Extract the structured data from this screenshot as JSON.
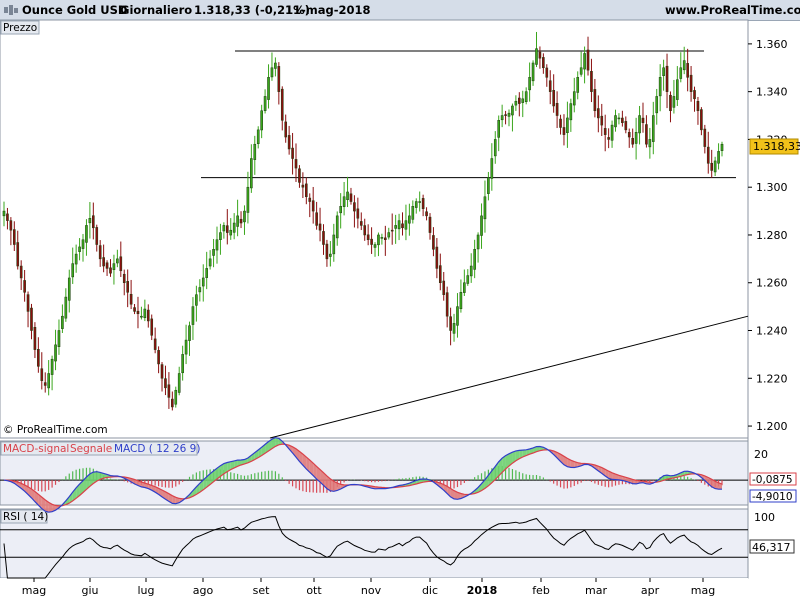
{
  "header": {
    "instrument": "Ounce Gold USD",
    "timeframe": "Giornaliero",
    "last_quote": "1.318,33 (-0,21%)",
    "date": "11-mag-2018",
    "site": "www.ProRealTime.com"
  },
  "price_pane": {
    "tag": "Prezzo",
    "copyright": "© ProRealTime.com",
    "last_price_label": "1.318,33",
    "y_ticks": [
      "1.360",
      "1.340",
      "1.320",
      "1.300",
      "1.280",
      "1.260",
      "1.240",
      "1.220",
      "1.200"
    ]
  },
  "macd_pane": {
    "tag_signal": "MACD-signal",
    "tag_line": "Segnale",
    "tag_macd": "MACD ( 12 26 9)",
    "y_tick": "20",
    "value_1": "-0,0875",
    "value_2": "-4,9010"
  },
  "rsi_pane": {
    "tag": "RSI ( 14)",
    "y_tick": "100",
    "value": "46,317"
  },
  "x_axis": {
    "labels": [
      "mag",
      "giu",
      "lug",
      "ago",
      "set",
      "ott",
      "nov",
      "dic",
      "2018",
      "feb",
      "mar",
      "apr",
      "mag"
    ]
  },
  "colors": {
    "header_bg": "#d5dde8",
    "panel_bg": "#ffffff",
    "bull_candle": "#3aa61c",
    "bear_candle": "#8a0f0f",
    "macd_line": "#2f3fc9",
    "signal_line": "#d9424a",
    "macd_fill_up": "#6fd06f",
    "macd_fill_down": "#e07a7a",
    "last_price_bg": "#f2c21a"
  },
  "chart_data": [
    {
      "type": "candlestick",
      "title": "Ounce Gold USD",
      "series": [
        {
          "name": "Ounce Gold USD",
          "close": [
            1290,
            1286,
            1282,
            1276,
            1267,
            1262,
            1256,
            1248,
            1240,
            1232,
            1225,
            1219,
            1217,
            1222,
            1228,
            1234,
            1240,
            1246,
            1254,
            1262,
            1268,
            1272,
            1275,
            1278,
            1284,
            1287,
            1283,
            1276,
            1270,
            1267,
            1266,
            1264,
            1268,
            1270,
            1265,
            1260,
            1256,
            1251,
            1248,
            1247,
            1246,
            1249,
            1244,
            1238,
            1232,
            1226,
            1220,
            1216,
            1212,
            1208,
            1215,
            1222,
            1230,
            1236,
            1242,
            1250,
            1255,
            1258,
            1262,
            1266,
            1270,
            1274,
            1278,
            1281,
            1284,
            1281,
            1282,
            1285,
            1288,
            1285,
            1290,
            1300,
            1312,
            1318,
            1324,
            1332,
            1338,
            1346,
            1350,
            1352,
            1340,
            1328,
            1321,
            1316,
            1312,
            1308,
            1302,
            1300,
            1296,
            1294,
            1290,
            1284,
            1282,
            1276,
            1270,
            1272,
            1280,
            1288,
            1292,
            1296,
            1298,
            1294,
            1290,
            1287,
            1284,
            1280,
            1278,
            1276,
            1276,
            1280,
            1279,
            1278,
            1281,
            1282,
            1284,
            1286,
            1283,
            1286,
            1288,
            1292,
            1294,
            1294,
            1291,
            1288,
            1281,
            1274,
            1266,
            1260,
            1255,
            1246,
            1240,
            1243,
            1250,
            1256,
            1260,
            1263,
            1267,
            1274,
            1280,
            1288,
            1296,
            1304,
            1312,
            1320,
            1328,
            1330,
            1330,
            1331,
            1334,
            1336,
            1335,
            1337,
            1340,
            1346,
            1352,
            1358,
            1354,
            1350,
            1346,
            1340,
            1334,
            1330,
            1325,
            1322,
            1329,
            1335,
            1340,
            1346,
            1350,
            1356,
            1349,
            1340,
            1332,
            1329,
            1326,
            1322,
            1320,
            1326,
            1330,
            1329,
            1327,
            1324,
            1321,
            1318,
            1323,
            1330,
            1327,
            1318,
            1320,
            1330,
            1338,
            1346,
            1350,
            1340,
            1332,
            1338,
            1345,
            1350,
            1353,
            1346,
            1340,
            1337,
            1332,
            1324,
            1317,
            1310,
            1307,
            1311,
            1315,
            1318
          ]
        }
      ],
      "xlabel": "",
      "ylabel": "",
      "ylim": [
        1195,
        1370
      ],
      "x_labels": [
        "mag",
        "giu",
        "lug",
        "ago",
        "set",
        "ott",
        "nov",
        "dic",
        "2018",
        "feb",
        "mar",
        "apr",
        "mag"
      ],
      "annotations": [
        "resistance line 1.357",
        "support line 1.304",
        "rising trendline"
      ],
      "grid": false
    },
    {
      "type": "line",
      "title": "MACD ( 12 26 9)",
      "series_names": [
        "MACD",
        "Segnale",
        "MACD-signal"
      ],
      "last_values": [
        -0.0875,
        -4.901
      ],
      "ylim": [
        -14,
        22
      ]
    },
    {
      "type": "line",
      "title": "RSI ( 14)",
      "series": [
        {
          "name": "RSI ( 14)",
          "last_value": 46.317
        }
      ],
      "ylim": [
        0,
        100
      ],
      "levels": [
        70,
        30
      ]
    }
  ]
}
